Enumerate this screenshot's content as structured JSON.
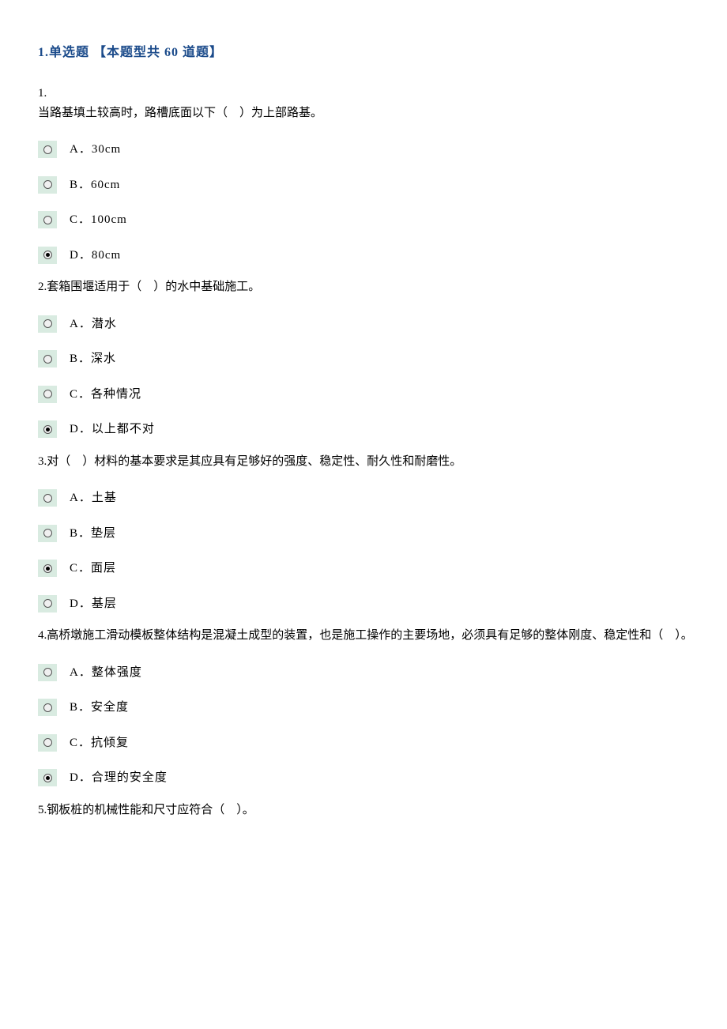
{
  "heading": "1.单选题 【本题型共 60 道题】",
  "questions": [
    {
      "num": "1.",
      "text": "当路基填土较高时，路槽底面以下（　）为上部路基。",
      "split_num_text": true,
      "selected": 3,
      "options": [
        "A．30cm",
        "B．60cm",
        "C．100cm",
        "D．80cm"
      ]
    },
    {
      "num": "2.",
      "text": "套箱围堰适用于（　）的水中基础施工。",
      "split_num_text": false,
      "selected": 3,
      "options": [
        "A．潜水",
        "B．深水",
        "C．各种情况",
        "D．以上都不对"
      ]
    },
    {
      "num": "3.",
      "text": "对（　）材料的基本要求是其应具有足够好的强度、稳定性、耐久性和耐磨性。",
      "split_num_text": false,
      "selected": 2,
      "options": [
        "A．土基",
        "B．垫层",
        "C．面层",
        "D．基层"
      ]
    },
    {
      "num": "4.",
      "text": "高桥墩施工滑动模板整体结构是混凝土成型的装置，也是施工操作的主要场地，必须具有足够的整体刚度、稳定性和（　）。",
      "split_num_text": false,
      "selected": 3,
      "options": [
        "A．整体强度",
        "B．安全度",
        "C．抗倾复",
        "D．合理的安全度"
      ]
    },
    {
      "num": "5.",
      "text": "钢板桩的机械性能和尺寸应符合（　）。",
      "split_num_text": false,
      "selected": -1,
      "options": []
    }
  ]
}
